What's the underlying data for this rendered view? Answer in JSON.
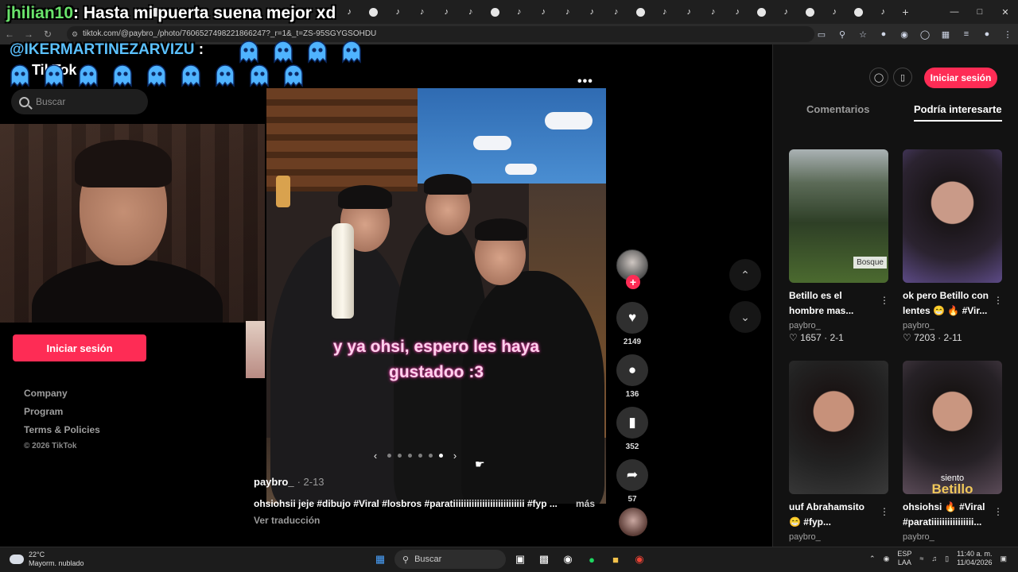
{
  "browser": {
    "url": "tiktok.com/@paybro_/photo/7606527498221866247?_r=1&_t=ZS-95SGYGSOHDU",
    "new_tab": "+",
    "tab_favicon_count": 31
  },
  "sidebar": {
    "logo": "TikTok",
    "search_placeholder": "Buscar",
    "login_label": "Iniciar sesión",
    "footer_links": [
      "Company",
      "Program",
      "Terms & Policies"
    ],
    "copyright": "© 2026 TikTok"
  },
  "post": {
    "overlay_text_line1": "y ya ohsi, espero les haya",
    "overlay_text_line2": "gustadoo :3",
    "username": "paybro_",
    "date": "· 2-13",
    "caption": "ohsiohsii jeje #dibujo #Viral #losbros #paratiiiiiiiiiiiiiiiiiiiiiiiiiii #fyp ...",
    "more": "más",
    "translate": "Ver traducción",
    "slide_count": 6,
    "active_slide": 5
  },
  "actions": {
    "likes": "2149",
    "comments": "136",
    "saves": "352",
    "shares": "57"
  },
  "right_panel": {
    "login_label": "Iniciar sesión",
    "tabs": [
      "Comentarios",
      "Podría interesarte"
    ],
    "active_tab": 1,
    "cards": [
      {
        "title": "Betillo es el hombre mas...",
        "user": "paybro_",
        "meta": "♡ 1657 · 2-1",
        "thumb_label": "Bosque"
      },
      {
        "title": "ok pero Betillo con lentes 😁 🔥 #Vir...",
        "user": "paybro_",
        "meta": "♡ 7203 · 2-11",
        "thumb_label": ""
      },
      {
        "title": "uuf Abrahamsito 😁 #fyp...",
        "user": "paybro_",
        "meta": "",
        "thumb_label": ""
      },
      {
        "title": "ohsiohsi 🔥 #Viral #paratiiiiiiiiiiiiiiii...",
        "user": "paybro_",
        "meta": "",
        "thumb_label": "siento",
        "thumb_big": "Betillo"
      }
    ]
  },
  "stream_chat": {
    "line1_user": "jhilian10",
    "line1_text": ": Hasta mi puerta suena mejor xd",
    "line2_user": "@IKERMARTINEZARVIZU",
    "line2_text": " :"
  },
  "taskbar": {
    "weather_temp": "22°C",
    "weather_desc": "Mayorm. nublado",
    "search_label": "Buscar",
    "lang_top": "ESP",
    "lang_bottom": "LAA",
    "time": "11:40 a. m.",
    "date": "11/04/2026"
  },
  "colors": {
    "tiktok_red": "#fe2c55",
    "chat_green": "#69e36b",
    "chat_blue": "#5bc1ff",
    "overlay_pink": "#ffd1ec"
  }
}
